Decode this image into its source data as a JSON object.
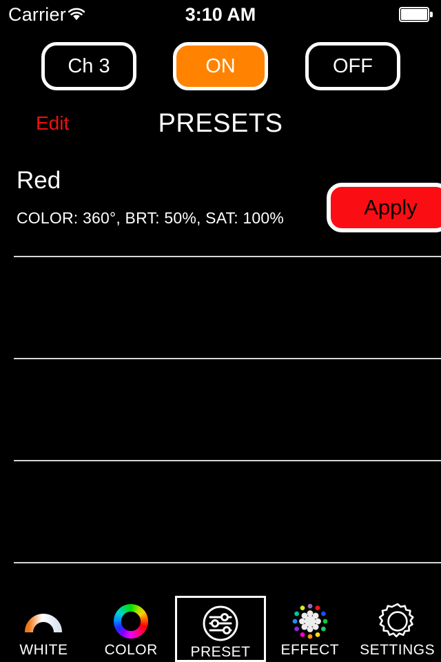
{
  "status_bar": {
    "carrier": "Carrier",
    "wifi_icon": "wifi-icon",
    "time": "3:10 AM",
    "battery_icon": "battery-full-icon"
  },
  "header": {
    "channel_button": "Ch 3",
    "on_button": "ON",
    "off_button": "OFF",
    "edit_link": "Edit",
    "title": "PRESETS",
    "on_button_color": "#FF8200",
    "edit_link_color": "#EE1111"
  },
  "presets": [
    {
      "name": "Red",
      "detail": "COLOR: 360°, BRT: 50%, SAT: 100%",
      "apply_label": "Apply",
      "apply_color": "#FA0E13"
    },
    {
      "name": "",
      "detail": "",
      "apply_label": "",
      "apply_color": ""
    },
    {
      "name": "",
      "detail": "",
      "apply_label": "",
      "apply_color": ""
    },
    {
      "name": "",
      "detail": "",
      "apply_label": "",
      "apply_color": ""
    }
  ],
  "tab_bar": {
    "selected": "PRESET",
    "items": [
      {
        "label": "WHITE",
        "icon": "white-gradient-arc-icon"
      },
      {
        "label": "COLOR",
        "icon": "color-wheel-ring-icon"
      },
      {
        "label": "PRESET",
        "icon": "sliders-circle-icon"
      },
      {
        "label": "EFFECT",
        "icon": "effect-dots-starburst-icon"
      },
      {
        "label": "SETTINGS",
        "icon": "gear-icon"
      }
    ]
  }
}
